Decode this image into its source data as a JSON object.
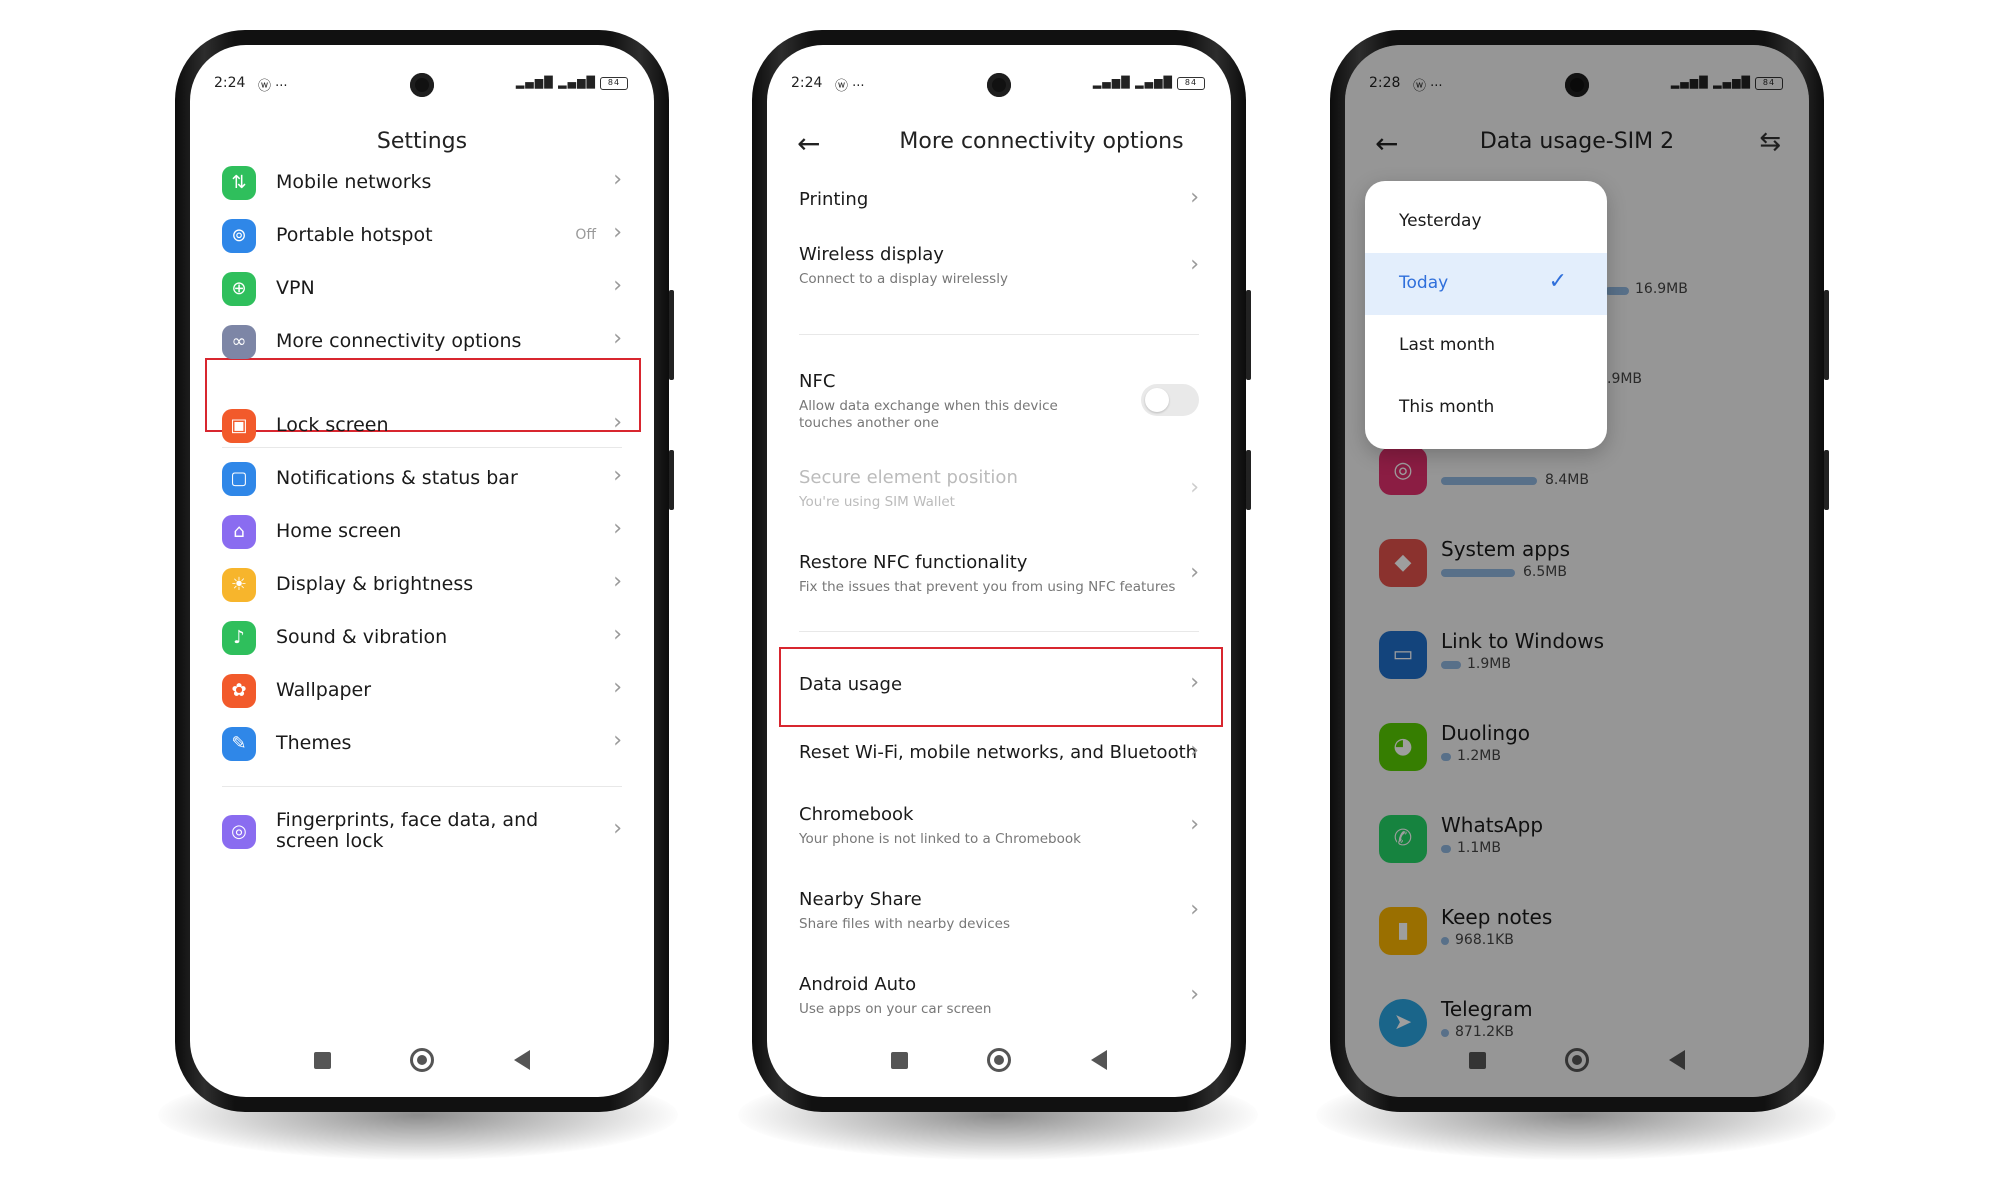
{
  "phone1": {
    "status_time": "2:24",
    "status_extra": "ⓦ ···",
    "signal": "▂▄▆█ ▂▄▆█",
    "battery": "84",
    "title": "Settings",
    "items": [
      {
        "label": "Mobile networks",
        "icon": "mobile-networks-icon",
        "color": "#2fbf5c"
      },
      {
        "label": "Portable hotspot",
        "value": "Off",
        "icon": "hotspot-icon",
        "color": "#2f87e8"
      },
      {
        "label": "VPN",
        "icon": "vpn-icon",
        "color": "#2fbf5c"
      },
      {
        "label": "More connectivity options",
        "icon": "link-icon",
        "color": "#7d86a6"
      },
      {
        "label": "Lock screen",
        "icon": "lock-icon",
        "color": "#f25a2b"
      },
      {
        "label": "Notifications & status bar",
        "icon": "notifications-icon",
        "color": "#2f87e8"
      },
      {
        "label": "Home screen",
        "icon": "home-icon",
        "color": "#8a6cf0"
      },
      {
        "label": "Display & brightness",
        "icon": "sun-icon",
        "color": "#f7b52c"
      },
      {
        "label": "Sound & vibration",
        "icon": "speaker-icon",
        "color": "#2fbf5c"
      },
      {
        "label": "Wallpaper",
        "icon": "wallpaper-icon",
        "color": "#f25a2b"
      },
      {
        "label": "Themes",
        "icon": "themes-icon",
        "color": "#2f87e8"
      },
      {
        "label": "Fingerprints, face data, and screen lock",
        "icon": "fingerprint-icon",
        "color": "#8a6cf0"
      }
    ]
  },
  "phone2": {
    "status_time": "2:24",
    "status_extra": "ⓦ ···",
    "signal": "▂▄▆█ ▂▄▆█",
    "battery": "84",
    "title": "More connectivity options",
    "items": [
      {
        "title": "Printing",
        "subtitle": ""
      },
      {
        "title": "Wireless display",
        "subtitle": "Connect to a display wirelessly"
      },
      {
        "title": "NFC",
        "subtitle": "Allow data exchange when this device touches another one"
      },
      {
        "title": "Secure element position",
        "subtitle": "You're using SIM  Wallet"
      },
      {
        "title": "Restore NFC functionality",
        "subtitle": "Fix the issues that prevent you from using NFC features"
      },
      {
        "title": "Data usage",
        "subtitle": ""
      },
      {
        "title": "Reset Wi-Fi, mobile networks, and Bluetooth",
        "subtitle": ""
      },
      {
        "title": "Chromebook",
        "subtitle": "Your phone is not linked to a Chromebook"
      },
      {
        "title": "Nearby Share",
        "subtitle": "Share files with nearby devices"
      },
      {
        "title": "Android Auto",
        "subtitle": "Use apps on your car screen"
      }
    ]
  },
  "phone3": {
    "status_time": "2:28",
    "status_extra": "ⓦ ···",
    "signal": "▂▄▆█ ▂▄▆█",
    "battery": "84",
    "title": "Data usage-SIM 2",
    "dropdown": {
      "options": [
        "Yesterday",
        "Today",
        "Last month",
        "This month"
      ],
      "selected": "Today"
    },
    "partial_sizes": [
      "16.9MB",
      ".9MB"
    ],
    "apps": [
      {
        "name": "",
        "size": "8.4MB",
        "icon": "instagram-icon",
        "color": "#e1306c",
        "frac": 0.5
      },
      {
        "name": "System apps",
        "size": "6.5MB",
        "icon": "system-apps-icon",
        "color": "#e0524b",
        "frac": 0.38
      },
      {
        "name": "Link to Windows",
        "size": "1.9MB",
        "icon": "link-to-windows-icon",
        "color": "#1f6fc9",
        "frac": 0.11
      },
      {
        "name": "Duolingo",
        "size": "1.2MB",
        "icon": "duolingo-icon",
        "color": "#58cc02",
        "frac": 0.07
      },
      {
        "name": "WhatsApp",
        "size": "1.1MB",
        "icon": "whatsapp-icon",
        "color": "#25d366",
        "frac": 0.065
      },
      {
        "name": "Keep notes",
        "size": "968.1KB",
        "icon": "keep-notes-icon",
        "color": "#f8b400",
        "frac": 0.055
      },
      {
        "name": "Telegram",
        "size": "871.2KB",
        "icon": "telegram-icon",
        "color": "#2aa3df",
        "frac": 0.05
      }
    ]
  },
  "colors": {
    "highlight": "#d8262f",
    "accent": "#2f6fdb",
    "selected_bg": "#e3eefc"
  }
}
